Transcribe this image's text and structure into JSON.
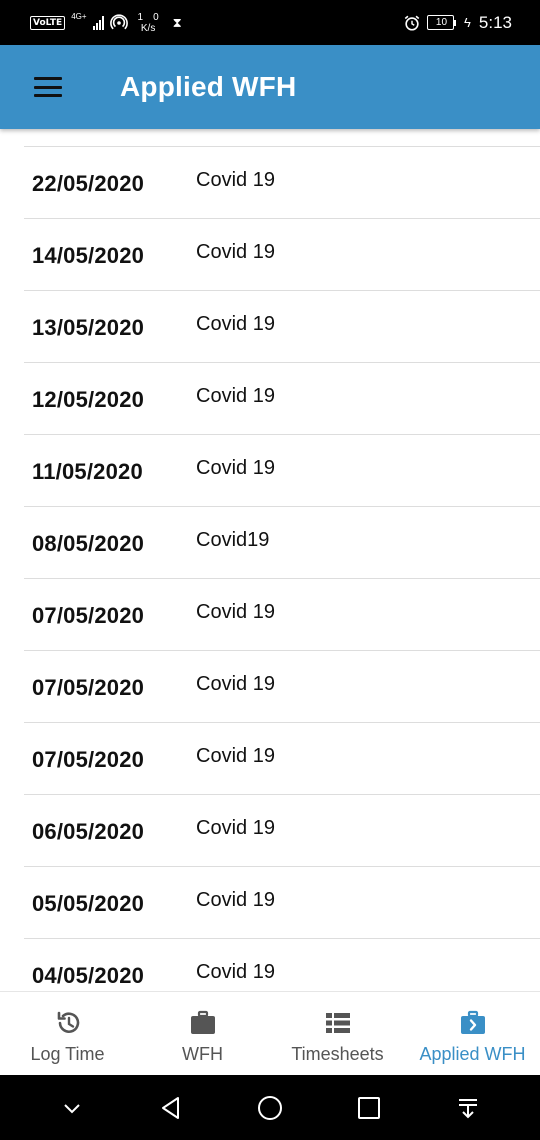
{
  "status_bar": {
    "volte": "VoLTE",
    "network": "4G+",
    "speed_up": "1",
    "speed_down": "0",
    "speed_unit": "K/s",
    "battery": "10",
    "time": "5:13"
  },
  "app_bar": {
    "title": "Applied WFH",
    "color": "#3a8fc6"
  },
  "list": {
    "rows": [
      {
        "date": "22/05/2020",
        "reason": "Covid 19"
      },
      {
        "date": "14/05/2020",
        "reason": "Covid 19"
      },
      {
        "date": "13/05/2020",
        "reason": "Covid 19"
      },
      {
        "date": "12/05/2020",
        "reason": "Covid 19"
      },
      {
        "date": "11/05/2020",
        "reason": "Covid 19"
      },
      {
        "date": "08/05/2020",
        "reason": "Covid19"
      },
      {
        "date": "07/05/2020",
        "reason": "Covid 19"
      },
      {
        "date": "07/05/2020",
        "reason": "Covid 19"
      },
      {
        "date": "07/05/2020",
        "reason": "Covid 19"
      },
      {
        "date": "06/05/2020",
        "reason": "Covid 19"
      },
      {
        "date": "05/05/2020",
        "reason": "Covid 19"
      },
      {
        "date": "04/05/2020",
        "reason": "Covid 19"
      }
    ]
  },
  "bottom_nav": {
    "items": [
      {
        "label": "Log Time",
        "icon": "history-clock-icon",
        "active": false
      },
      {
        "label": "WFH",
        "icon": "briefcase-icon",
        "active": false
      },
      {
        "label": "Timesheets",
        "icon": "list-icon",
        "active": false
      },
      {
        "label": "Applied WFH",
        "icon": "briefcase-arrow-icon",
        "active": true
      }
    ],
    "active_color": "#3a8fc6",
    "inactive_color": "#555555"
  }
}
